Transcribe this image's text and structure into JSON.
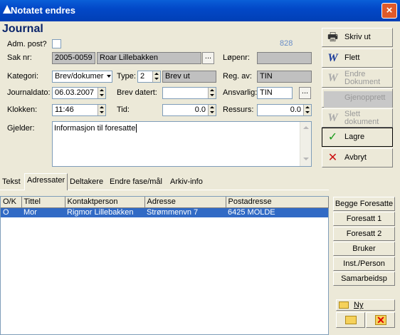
{
  "window": {
    "title": "Notatet endres",
    "close_glyph": "×"
  },
  "header": {
    "title": "Journal",
    "number": "828"
  },
  "form": {
    "adm_post_label": "Adm. post?",
    "sak_nr_label": "Sak nr:",
    "sak_nr": "2005-0059",
    "sak_name": "Roar Lillebakken",
    "lopenr_label": "Løpenr:",
    "lopenr": "",
    "kategori_label": "Kategori:",
    "kategori": "Brev/dokumer",
    "type_label": "Type:",
    "type_num": "2",
    "type_name": "Brev ut",
    "reg_av_label": "Reg. av:",
    "reg_av": "TIN",
    "journaldato_label": "Journaldato:",
    "journaldato": "06.03.2007",
    "brev_datert_label": "Brev datert:",
    "brev_datert": "",
    "ansvarlig_label": "Ansvarlig:",
    "ansvarlig": "TIN",
    "klokken_label": "Klokken:",
    "klokken": "11:46",
    "tid_label": "Tid:",
    "tid": "0.0",
    "ressurs_label": "Ressurs:",
    "ressurs": "0.0",
    "gjelder_label": "Gjelder:",
    "gjelder": "Informasjon til foresatte",
    "ellipsis": "..."
  },
  "actions": [
    {
      "label": "Skriv ut",
      "icon": "printer-icon",
      "enabled": true
    },
    {
      "label": "Flett",
      "icon": "merge-icon",
      "enabled": true
    },
    {
      "label": "Endre Dokument",
      "icon": "edit-document-icon",
      "enabled": false
    },
    {
      "label": "Gjenopprett",
      "icon": "restore-icon",
      "enabled": false
    },
    {
      "label": "Slett dokument",
      "icon": "delete-document-icon",
      "enabled": false
    },
    {
      "label": "Lagre",
      "icon": "checkmark-icon",
      "enabled": true
    },
    {
      "label": "Avbryt",
      "icon": "cancel-x-icon",
      "enabled": true
    }
  ],
  "tabs": [
    {
      "label": "Tekst"
    },
    {
      "label": "Adressater",
      "active": true
    },
    {
      "label": "Deltakere"
    },
    {
      "label": "Endre fase/mål"
    },
    {
      "label": "Arkiv-info"
    }
  ],
  "table": {
    "columns": [
      "O/K",
      "Tittel",
      "Kontaktperson",
      "Adresse",
      "Postadresse"
    ],
    "rows": [
      [
        "O",
        "Mor",
        "Rigmor Lillebakken",
        "Strømmenvn 7",
        "6425 MOLDE"
      ]
    ]
  },
  "side_buttons": [
    "Begge Foresatte",
    "Foresatt 1",
    "Foresatt 2",
    "Bruker",
    "Inst./Person",
    "Samarbeidsp"
  ],
  "bottom": {
    "new_label": "Ny"
  },
  "colors": {
    "titlebar": "#0248c8",
    "selection": "#316ac5",
    "header_text": "#0a246a"
  }
}
